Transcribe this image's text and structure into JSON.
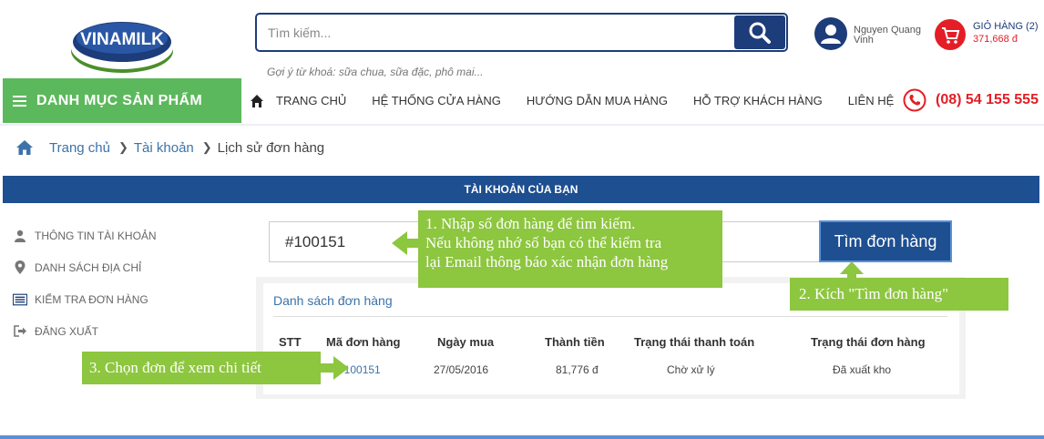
{
  "brand": {
    "logo_text": "VINAMILK",
    "primary_color": "#1d3c7a",
    "accent_green": "#5cb85c",
    "accent_red": "#e41e26"
  },
  "search": {
    "placeholder": "Tìm kiếm...",
    "hint": "Gợi ý từ khoá: sữa chua, sữa đặc, phô mai..."
  },
  "user": {
    "name": "Nguyen Quang Vinh"
  },
  "cart": {
    "label": "GIỎ HÀNG (2)",
    "total": "371,668 đ"
  },
  "nav": {
    "category_label": "DANH MỤC SẢN PHẨM",
    "items": [
      "TRANG CHỦ",
      "HỆ THỐNG CỬA HÀNG",
      "HƯỚNG DẪN MUA HÀNG",
      "HỖ TRỢ KHÁCH HÀNG",
      "LIÊN HỆ"
    ],
    "phone": "(08) 54 155 555"
  },
  "breadcrumb": {
    "home": "Trang chủ",
    "account": "Tài khoản",
    "current": "Lịch sử đơn hàng"
  },
  "account": {
    "header": "TÀI KHOẢN CỦA BẠN",
    "menu": [
      "THÔNG TIN TÀI KHOẢN",
      "DANH SÁCH ĐỊA CHỈ",
      "KIỂM TRA ĐƠN HÀNG",
      "ĐĂNG XUẤT"
    ]
  },
  "order_search": {
    "value": "#100151",
    "button": "Tìm đơn hàng"
  },
  "orders": {
    "title": "Danh sách đơn hàng",
    "columns": [
      "STT",
      "Mã đơn hàng",
      "Ngày mua",
      "Thành tiền",
      "Trạng thái thanh toán",
      "Trạng thái đơn hàng"
    ],
    "rows": [
      {
        "stt": "",
        "code": "#100151",
        "date": "27/05/2016",
        "amount": "81,776 đ",
        "payment": "Chờ xử lý",
        "status": "Đã xuất kho"
      }
    ]
  },
  "callouts": {
    "step1": [
      "1. Nhập số đơn hàng để tìm kiếm.",
      "Nếu không nhớ số bạn có thể kiểm tra",
      "lại Email thông báo xác nhận đơn hàng"
    ],
    "step2": "2. Kích \"Tìm đơn hàng\"",
    "step3": "3. Chọn đơn để xem chi tiết"
  }
}
